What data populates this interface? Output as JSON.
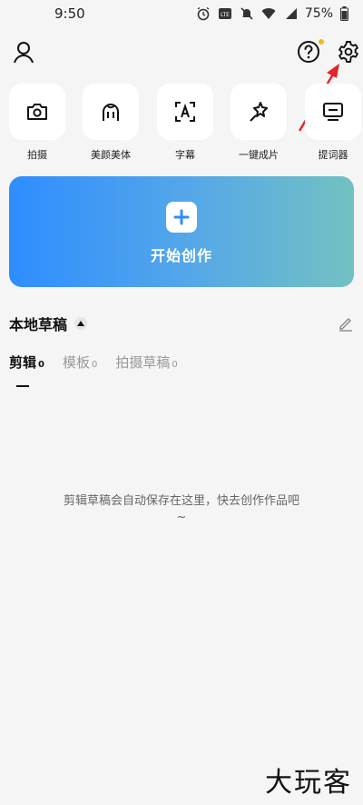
{
  "status_bar": {
    "time": "9:50",
    "icons": [
      "alarm-icon",
      "volte-icon",
      "mute-icon",
      "wifi-icon",
      "signal-4g-icon"
    ],
    "battery": "75%"
  },
  "header": {
    "profile_icon": "person-icon",
    "help_icon": "question-icon",
    "settings_icon": "gear-icon"
  },
  "tools": [
    {
      "label": "拍摄",
      "icon": "camera-icon"
    },
    {
      "label": "美颜美体",
      "icon": "beauty-icon"
    },
    {
      "label": "字幕",
      "icon": "subtitle-icon"
    },
    {
      "label": "一键成片",
      "icon": "magic-icon"
    },
    {
      "label": "提词器",
      "icon": "teleprompter-icon"
    }
  ],
  "create": {
    "label": "开始创作"
  },
  "drafts": {
    "title": "本地草稿",
    "tabs": [
      {
        "label": "剪辑",
        "count": "0"
      },
      {
        "label": "模板",
        "count": "0"
      },
      {
        "label": "拍摄草稿",
        "count": "0"
      }
    ],
    "empty_line1": "剪辑草稿会自动保存在这里，快去创作作品吧",
    "empty_line2": "~"
  },
  "watermark": "大玩客",
  "colors": {
    "accent_start": "#2e8dff",
    "accent_end": "#73c1c2",
    "arrow": "#e2232a",
    "help_dot": "#f5b914"
  }
}
